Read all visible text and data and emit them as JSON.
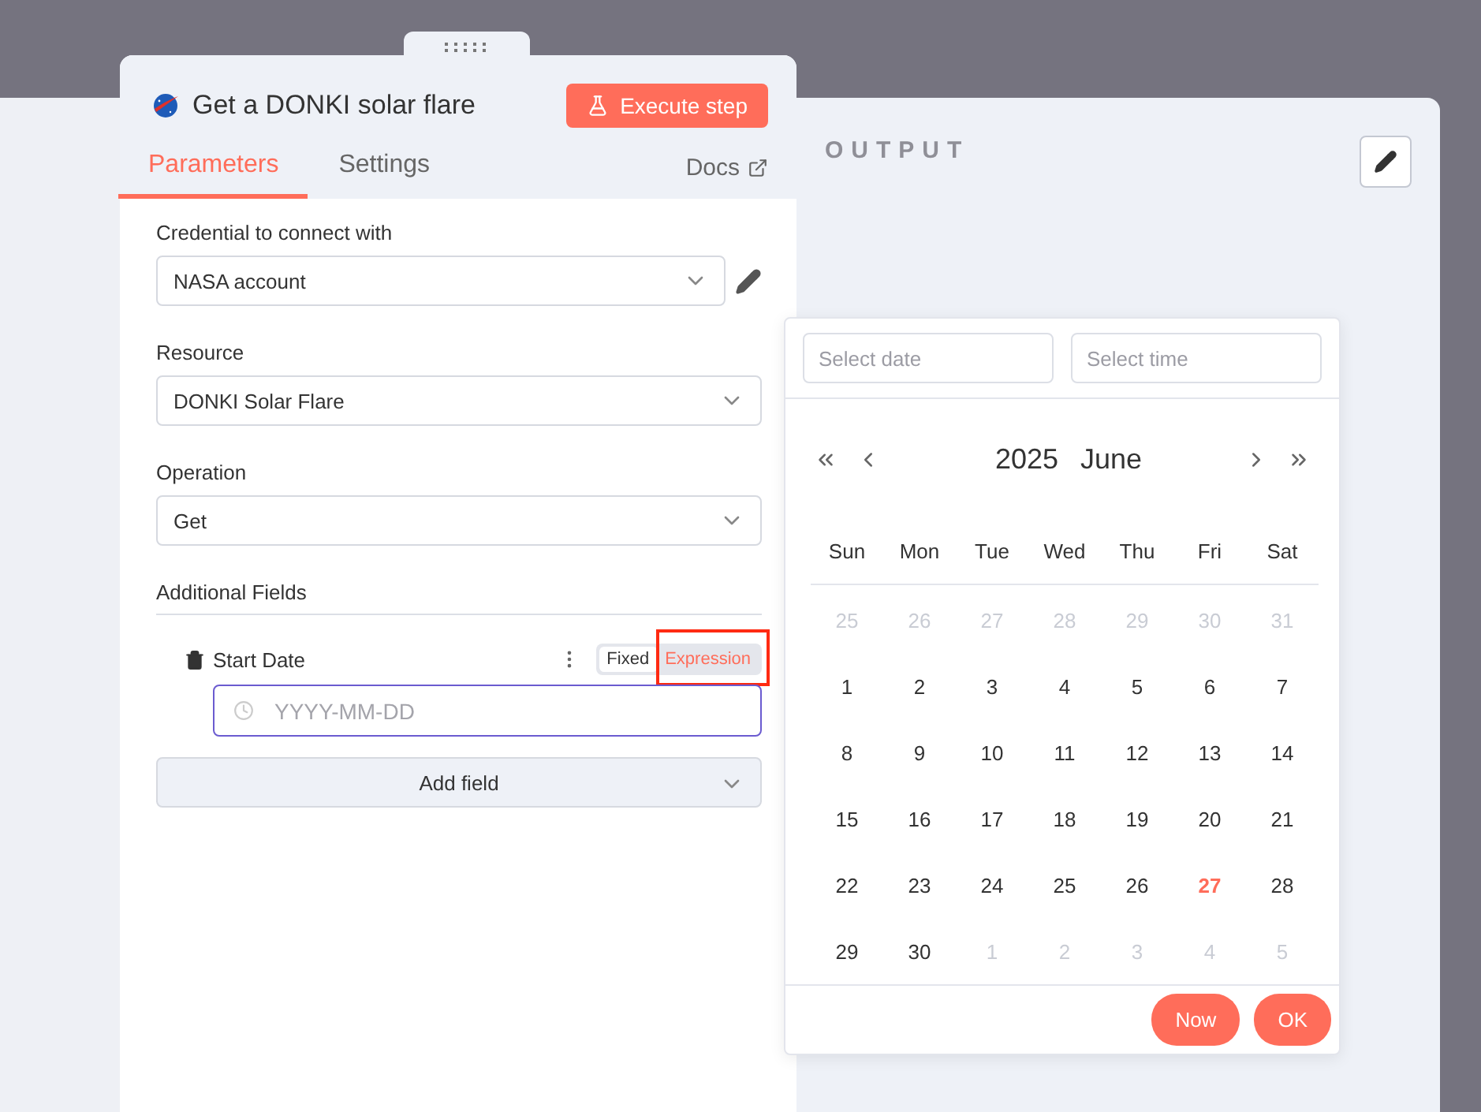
{
  "node": {
    "title": "Get a DONKI solar flare",
    "execute_button": "Execute step"
  },
  "tabs": [
    {
      "label": "Parameters",
      "selected": true
    },
    {
      "label": "Settings",
      "selected": false
    }
  ],
  "docs_link": "Docs",
  "parameters": [
    {
      "label": "Credential to connect with",
      "value": "NASA account",
      "editable": true
    },
    {
      "label": "Resource",
      "value": "DONKI Solar Flare",
      "editable": false
    },
    {
      "label": "Operation",
      "value": "Get",
      "editable": false
    }
  ],
  "additional_fields": {
    "heading": "Additional Fields",
    "fields": [
      {
        "label": "Start Date",
        "placeholder": "YYYY-MM-DD",
        "modes": [
          {
            "label": "Fixed",
            "selected": true,
            "highlighted": false
          },
          {
            "label": "Expression",
            "selected": false,
            "highlighted": true
          }
        ]
      }
    ],
    "add_button": "Add field"
  },
  "output": {
    "title": "OUTPUT"
  },
  "date_picker": {
    "date_placeholder": "Select date",
    "time_placeholder": "Select time",
    "year": "2025",
    "month": "June",
    "weekdays": [
      "Sun",
      "Mon",
      "Tue",
      "Wed",
      "Thu",
      "Fri",
      "Sat"
    ],
    "days": [
      {
        "label": "25",
        "outside": true,
        "today": false
      },
      {
        "label": "26",
        "outside": true,
        "today": false
      },
      {
        "label": "27",
        "outside": true,
        "today": false
      },
      {
        "label": "28",
        "outside": true,
        "today": false
      },
      {
        "label": "29",
        "outside": true,
        "today": false
      },
      {
        "label": "30",
        "outside": true,
        "today": false
      },
      {
        "label": "31",
        "outside": true,
        "today": false
      },
      {
        "label": "1",
        "outside": false,
        "today": false
      },
      {
        "label": "2",
        "outside": false,
        "today": false
      },
      {
        "label": "3",
        "outside": false,
        "today": false
      },
      {
        "label": "4",
        "outside": false,
        "today": false
      },
      {
        "label": "5",
        "outside": false,
        "today": false
      },
      {
        "label": "6",
        "outside": false,
        "today": false
      },
      {
        "label": "7",
        "outside": false,
        "today": false
      },
      {
        "label": "8",
        "outside": false,
        "today": false
      },
      {
        "label": "9",
        "outside": false,
        "today": false
      },
      {
        "label": "10",
        "outside": false,
        "today": false
      },
      {
        "label": "11",
        "outside": false,
        "today": false
      },
      {
        "label": "12",
        "outside": false,
        "today": false
      },
      {
        "label": "13",
        "outside": false,
        "today": false
      },
      {
        "label": "14",
        "outside": false,
        "today": false
      },
      {
        "label": "15",
        "outside": false,
        "today": false
      },
      {
        "label": "16",
        "outside": false,
        "today": false
      },
      {
        "label": "17",
        "outside": false,
        "today": false
      },
      {
        "label": "18",
        "outside": false,
        "today": false
      },
      {
        "label": "19",
        "outside": false,
        "today": false
      },
      {
        "label": "20",
        "outside": false,
        "today": false
      },
      {
        "label": "21",
        "outside": false,
        "today": false
      },
      {
        "label": "22",
        "outside": false,
        "today": false
      },
      {
        "label": "23",
        "outside": false,
        "today": false
      },
      {
        "label": "24",
        "outside": false,
        "today": false
      },
      {
        "label": "25",
        "outside": false,
        "today": false
      },
      {
        "label": "26",
        "outside": false,
        "today": false
      },
      {
        "label": "27",
        "outside": false,
        "today": true
      },
      {
        "label": "28",
        "outside": false,
        "today": false
      },
      {
        "label": "29",
        "outside": false,
        "today": false
      },
      {
        "label": "30",
        "outside": false,
        "today": false
      },
      {
        "label": "1",
        "outside": true,
        "today": false
      },
      {
        "label": "2",
        "outside": true,
        "today": false
      },
      {
        "label": "3",
        "outside": true,
        "today": false
      },
      {
        "label": "4",
        "outside": true,
        "today": false
      },
      {
        "label": "5",
        "outside": true,
        "today": false
      }
    ],
    "buttons": [
      "Now",
      "OK"
    ]
  }
}
